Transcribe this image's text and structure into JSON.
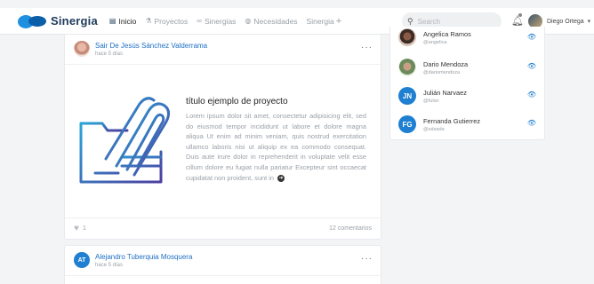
{
  "brand": {
    "name": "Sinergia"
  },
  "nav": [
    {
      "icon": "home-icon",
      "glyph": "▤",
      "label": "Inicio",
      "active": true
    },
    {
      "icon": "projects-icon",
      "glyph": "⚗",
      "label": "Proyectos",
      "active": false
    },
    {
      "icon": "link-icon",
      "glyph": "∞",
      "label": "Sinergias",
      "active": false
    },
    {
      "icon": "globe-icon",
      "glyph": "◍",
      "label": "Necesidades",
      "active": false
    },
    {
      "icon": "plus-icon",
      "glyph": "",
      "label": "Sinergia",
      "active": false,
      "plus": "+"
    }
  ],
  "search": {
    "placeholder": "Search"
  },
  "user": {
    "name": "Diego Ortega",
    "caret": "▾"
  },
  "suggestions": [
    {
      "name": "Angelica Ramos",
      "handle": "@angelica",
      "avatar": "photo"
    },
    {
      "name": "Dario Mendoza",
      "handle": "@dariomendoza",
      "avatar": "photo"
    },
    {
      "name": "Julián Narvaez",
      "handle": "@fulso",
      "avatar": "initials",
      "initials": "JN"
    },
    {
      "name": "Fernanda Gutierrez",
      "handle": "@sdsada",
      "avatar": "initials",
      "initials": "FG"
    }
  ],
  "posts": [
    {
      "author": "Sair De Jesús Sánchez Valderrama",
      "time": "hace 5 días",
      "project_title": "título ejemplo de proyecto",
      "project_text": "Lorem ipsum dolor sit amet, consectetur adipisicing elit, sed do eiusmod tempor incididunt ut labore et dolore magna aliqua Ut enim ad minim veniam, quis nostrud exercitation ullamco laboris nisi ut aliquip ex ea commodo consequat. Duis aute irure dolor in reprehenderit in voluptate velit esse cillum dolore eu fugiat nulla pariatur Excepteur sint occaecat cupidatat non proident, sunt in",
      "likes": "1",
      "comments": "12 comentarios"
    },
    {
      "author": "Alejandro Tuberquia Mosquera",
      "time": "hace 5 días",
      "initials": "AT"
    }
  ],
  "colors": {
    "accent": "#1f7fd0",
    "brand_dark": "#1f3a5a",
    "clip_from": "#2aa6d8",
    "clip_to": "#4c3fa0"
  }
}
